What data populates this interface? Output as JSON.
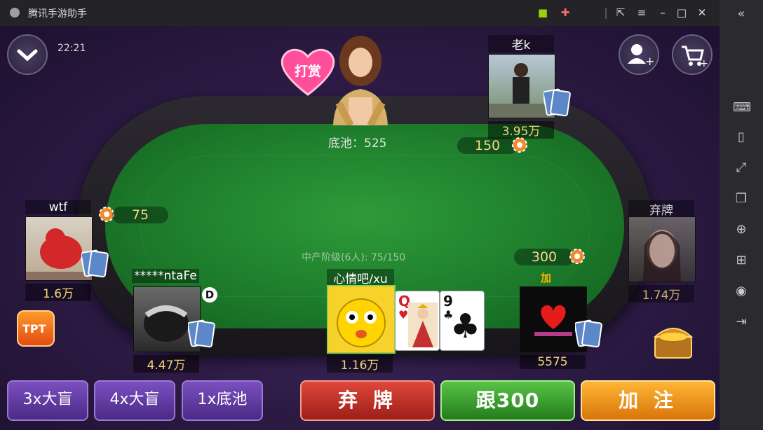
{
  "window": {
    "title": "腾讯手游助手"
  },
  "icons": {
    "logo": "tencent-assistant-icon",
    "gift": "gift-icon",
    "chip": "chip-icon",
    "menu": "menu-icon"
  },
  "hud": {
    "time": "22:21",
    "collapse_icon": "chevron-down-icon",
    "add_friend_icon": "add-user-icon",
    "shop_icon": "cart-icon",
    "tip_label": "打赏"
  },
  "table": {
    "pot": "底池：525",
    "level": "中产阶级(6人): 75/150"
  },
  "players": {
    "top": {
      "name": "老k",
      "chips": "3.95万",
      "bet": "150"
    },
    "left": {
      "name": "wtf",
      "chips": "1.6万",
      "bet": "75"
    },
    "left_bottom": {
      "name": "*****ntaFe",
      "chips": "4.47万",
      "dealer": "D"
    },
    "me": {
      "name": "心情吧/xu",
      "chips": "1.16万"
    },
    "right_bottom": {
      "name": "加注",
      "chips": "5575",
      "bet": "300"
    },
    "right": {
      "name": "弃牌",
      "chips": "1.74万"
    }
  },
  "my_cards": [
    {
      "rank": "Q",
      "suit": "♥",
      "color": "#d3202b"
    },
    {
      "rank": "9",
      "suit": "♣",
      "color": "#111111"
    }
  ],
  "buttons": {
    "blind3": "3x大盲",
    "blind4": "4x大盲",
    "pot1": "1x底池",
    "fold": "弃 牌",
    "call": "跟300",
    "raise": "加 注"
  },
  "colors": {
    "fold": "#c0332a",
    "call": "#3d9b2e",
    "raise": "#e89414",
    "felt": "#1c7a2a"
  }
}
